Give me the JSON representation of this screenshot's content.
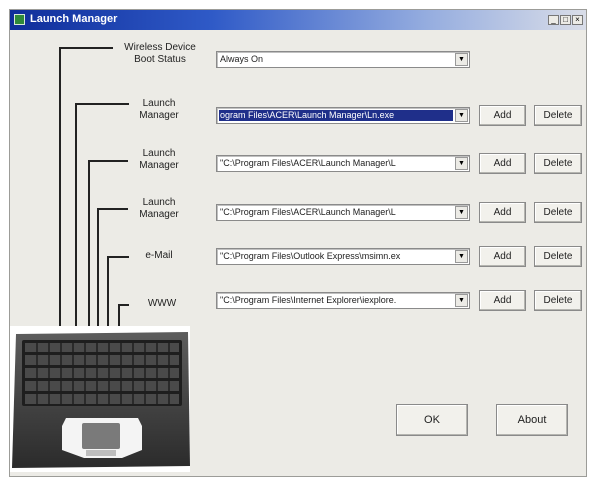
{
  "window": {
    "title": "Launch Manager",
    "controls": [
      "_",
      "□",
      "×"
    ]
  },
  "wireless": {
    "label_line1": "Wireless Device",
    "label_line2": "Boot Status",
    "value": "Always On"
  },
  "rows": [
    {
      "label_line1": "Launch",
      "label_line2": "Manager",
      "value": "ogram Files\\ACER\\Launch Manager\\Ln.exe",
      "selected": true,
      "add": "Add",
      "delete": "Delete"
    },
    {
      "label_line1": "Launch",
      "label_line2": "Manager",
      "value": "\"C:\\Program Files\\ACER\\Launch Manager\\L",
      "selected": false,
      "add": "Add",
      "delete": "Delete"
    },
    {
      "label_line1": "Launch",
      "label_line2": "Manager",
      "value": "\"C:\\Program Files\\ACER\\Launch Manager\\L",
      "selected": false,
      "add": "Add",
      "delete": "Delete"
    },
    {
      "label_line1": "e-Mail",
      "label_line2": "",
      "value": "\"C:\\Program Files\\Outlook Express\\msimn.ex",
      "selected": false,
      "add": "Add",
      "delete": "Delete"
    },
    {
      "label_line1": "WWW",
      "label_line2": "",
      "value": "\"C:\\Program Files\\Internet Explorer\\iexplore.",
      "selected": false,
      "add": "Add",
      "delete": "Delete"
    }
  ],
  "buttons": {
    "ok": "OK",
    "about": "About"
  },
  "colors": {
    "titlebar_start": "#0f2d9a",
    "window_bg": "#ecebe6",
    "selection": "#1f2f8a"
  },
  "icons": {
    "app": "app-icon",
    "dropdown": "chevron-down-icon",
    "laptop": "laptop-keyboard-icon"
  }
}
